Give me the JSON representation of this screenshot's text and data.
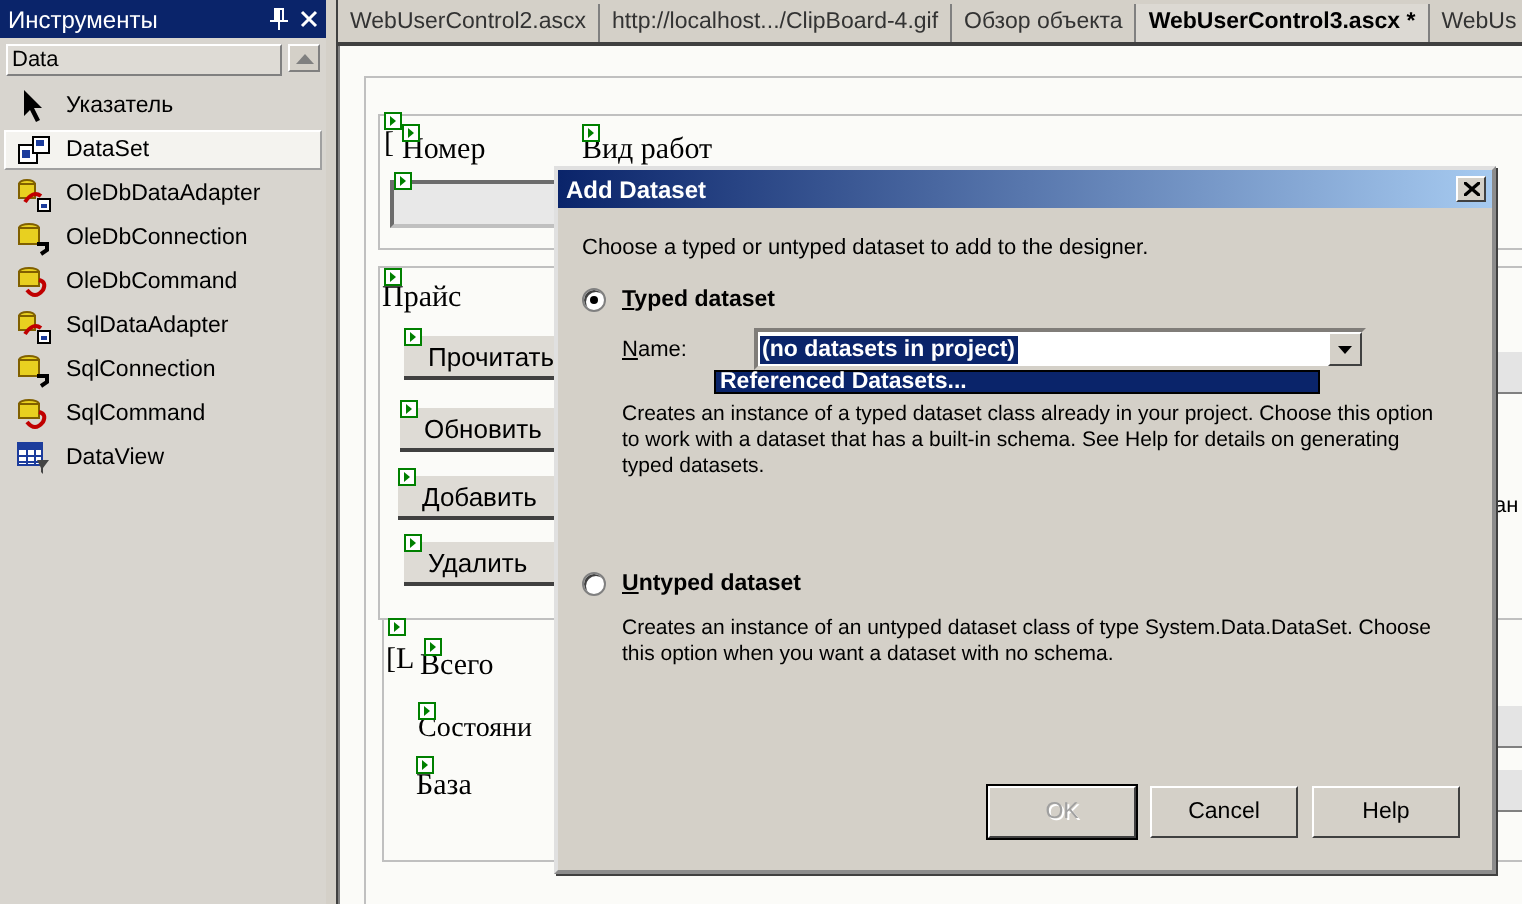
{
  "toolbox": {
    "title": "Инструменты",
    "category": "Data",
    "items": [
      {
        "label": "Указатель",
        "kind": "pointer",
        "selected": false
      },
      {
        "label": "DataSet",
        "kind": "dataset",
        "selected": true
      },
      {
        "label": "OleDbDataAdapter",
        "kind": "adapter",
        "selected": false
      },
      {
        "label": "OleDbConnection",
        "kind": "connection",
        "selected": false
      },
      {
        "label": "OleDbCommand",
        "kind": "command",
        "selected": false
      },
      {
        "label": "SqlDataAdapter",
        "kind": "adapter",
        "selected": false
      },
      {
        "label": "SqlConnection",
        "kind": "connection",
        "selected": false
      },
      {
        "label": "SqlCommand",
        "kind": "command",
        "selected": false
      },
      {
        "label": "DataView",
        "kind": "view",
        "selected": false
      }
    ]
  },
  "tabs": [
    {
      "label": "WebUserControl2.ascx",
      "selected": false
    },
    {
      "label": "http://localhost.../ClipBoard-4.gif",
      "selected": false
    },
    {
      "label": "Обзор объекта",
      "selected": false
    },
    {
      "label": "WebUserControl3.ascx *",
      "selected": true
    },
    {
      "label": "WebUs",
      "selected": false
    }
  ],
  "designer": {
    "bracket_marks": [
      "[",
      "[L"
    ],
    "column_labels": [
      "Номер",
      "Вид работ"
    ],
    "section_title": "Прайс",
    "buttons": [
      "Прочитать",
      "Обновить",
      "Добавить",
      "Удалить"
    ],
    "footer_labels": [
      "Всего",
      "Состояни",
      "База"
    ],
    "right_edge_text": "ан"
  },
  "dialog": {
    "title": "Add Dataset",
    "intro": "Choose a typed or untyped dataset to add to the designer.",
    "options": [
      {
        "label": "Typed dataset",
        "selected": true,
        "description": "Creates an instance of a typed dataset class already in your project. Choose this option to work with a dataset that has a built-in schema. See Help for details on generating typed datasets."
      },
      {
        "label": "Untyped dataset",
        "selected": false,
        "description": "Creates an instance of an untyped dataset class of type System.Data.DataSet. Choose this option when you want a dataset with no schema."
      }
    ],
    "name_field": {
      "label": "Name:",
      "value": "(no datasets in project)",
      "list_items": [
        {
          "label": "Referenced Datasets...",
          "selected": true
        }
      ]
    },
    "buttons": [
      {
        "label": "OK",
        "disabled": true,
        "default": true
      },
      {
        "label": "Cancel",
        "disabled": false,
        "default": false
      },
      {
        "label": "Help",
        "disabled": false,
        "default": false
      }
    ]
  }
}
